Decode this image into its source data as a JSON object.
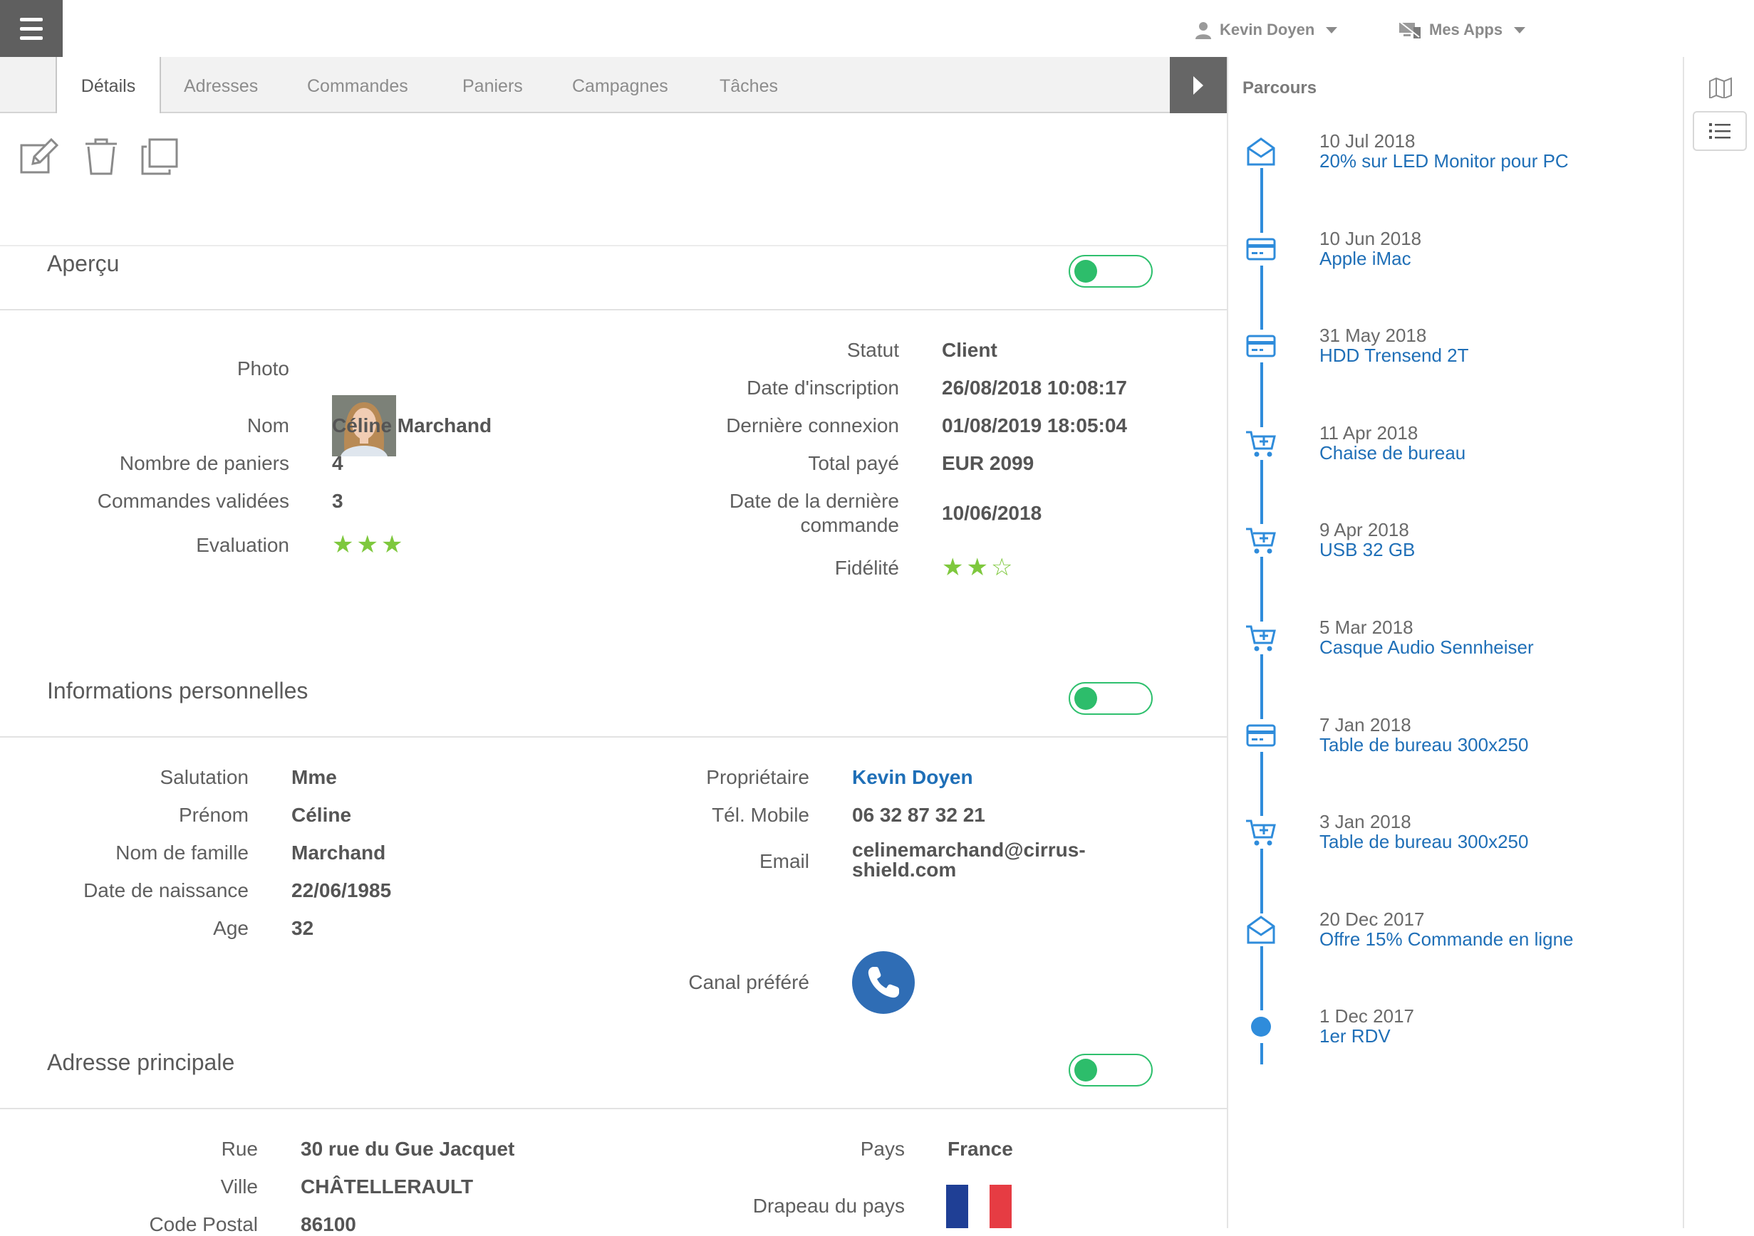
{
  "topbar": {
    "user_name": "Kevin Doyen",
    "apps_label": "Mes Apps"
  },
  "tabs": [
    {
      "label": "Détails",
      "active": true
    },
    {
      "label": "Adresses"
    },
    {
      "label": "Commandes"
    },
    {
      "label": "Paniers"
    },
    {
      "label": "Campagnes"
    },
    {
      "label": "Tâches"
    }
  ],
  "sections": {
    "apercu": "Aperçu",
    "infos": "Informations personnelles",
    "adresse": "Adresse principale"
  },
  "apercu": {
    "photo_label": "Photo",
    "nom_label": "Nom",
    "nom": "Céline Marchand",
    "paniers_label": "Nombre de paniers",
    "paniers": "4",
    "commandes_label": "Commandes validées",
    "commandes": "3",
    "evaluation_label": "Evaluation",
    "evaluation": 3,
    "statut_label": "Statut",
    "statut": "Client",
    "inscription_label": "Date d'inscription",
    "inscription": "26/08/2018 10:08:17",
    "connexion_label": "Dernière connexion",
    "connexion": "01/08/2019 18:05:04",
    "total_label": "Total payé",
    "total": "EUR 2099",
    "derniere_cmd_label_1": "Date de la dernière",
    "derniere_cmd_label_2": "commande",
    "derniere_cmd": "10/06/2018",
    "fidelite_label": "Fidélité",
    "fidelite": 2,
    "fidelite_max": 3
  },
  "infos": {
    "salutation_label": "Salutation",
    "salutation": "Mme",
    "prenom_label": "Prénom",
    "prenom": "Céline",
    "nom_famille_label": "Nom de famille",
    "nom_famille": "Marchand",
    "naissance_label": "Date de naissance",
    "naissance": "22/06/1985",
    "age_label": "Age",
    "age": "32",
    "proprietaire_label": "Propriétaire",
    "proprietaire": "Kevin Doyen",
    "mobile_label": "Tél. Mobile",
    "mobile": "06 32 87 32 21",
    "email_label": "Email",
    "email_1": "celinemarchand@cirrus-",
    "email_2": "shield.com",
    "canal_label": "Canal préféré",
    "canal_icon": "phone-icon"
  },
  "adresse": {
    "rue_label": "Rue",
    "rue": "30 rue du Gue Jacquet",
    "ville_label": "Ville",
    "ville": "CHÂTELLERAULT",
    "cp_label": "Code Postal",
    "cp": "86100",
    "pays_label": "Pays",
    "pays": "France",
    "drapeau_label": "Drapeau du pays",
    "flag_colors": [
      "#1f3f95",
      "#ffffff",
      "#e63c43"
    ]
  },
  "parcours": {
    "title": "Parcours",
    "accent": "#2f8cdb",
    "items": [
      {
        "date": "10 Jul 2018",
        "label": "20% sur LED Monitor pour PC",
        "icon": "email-open-icon"
      },
      {
        "date": "10 Jun 2018",
        "label": "Apple iMac",
        "icon": "credit-card-icon"
      },
      {
        "date": "31 May 2018",
        "label": "HDD Trensend 2T",
        "icon": "credit-card-icon"
      },
      {
        "date": "11 Apr 2018",
        "label": "Chaise de bureau",
        "icon": "cart-add-icon"
      },
      {
        "date": "9 Apr 2018",
        "label": "USB 32 GB",
        "icon": "cart-add-icon"
      },
      {
        "date": "5 Mar 2018",
        "label": "Casque Audio Sennheiser",
        "icon": "cart-add-icon"
      },
      {
        "date": "7 Jan 2018",
        "label": "Table de bureau 300x250",
        "icon": "credit-card-icon"
      },
      {
        "date": "3 Jan 2018",
        "label": "Table de bureau 300x250",
        "icon": "cart-add-icon"
      },
      {
        "date": "20 Dec 2017",
        "label": "Offre 15% Commande en ligne",
        "icon": "email-open-icon"
      },
      {
        "date": "1 Dec 2017",
        "label": "1er RDV",
        "icon": "dot-icon"
      }
    ]
  }
}
